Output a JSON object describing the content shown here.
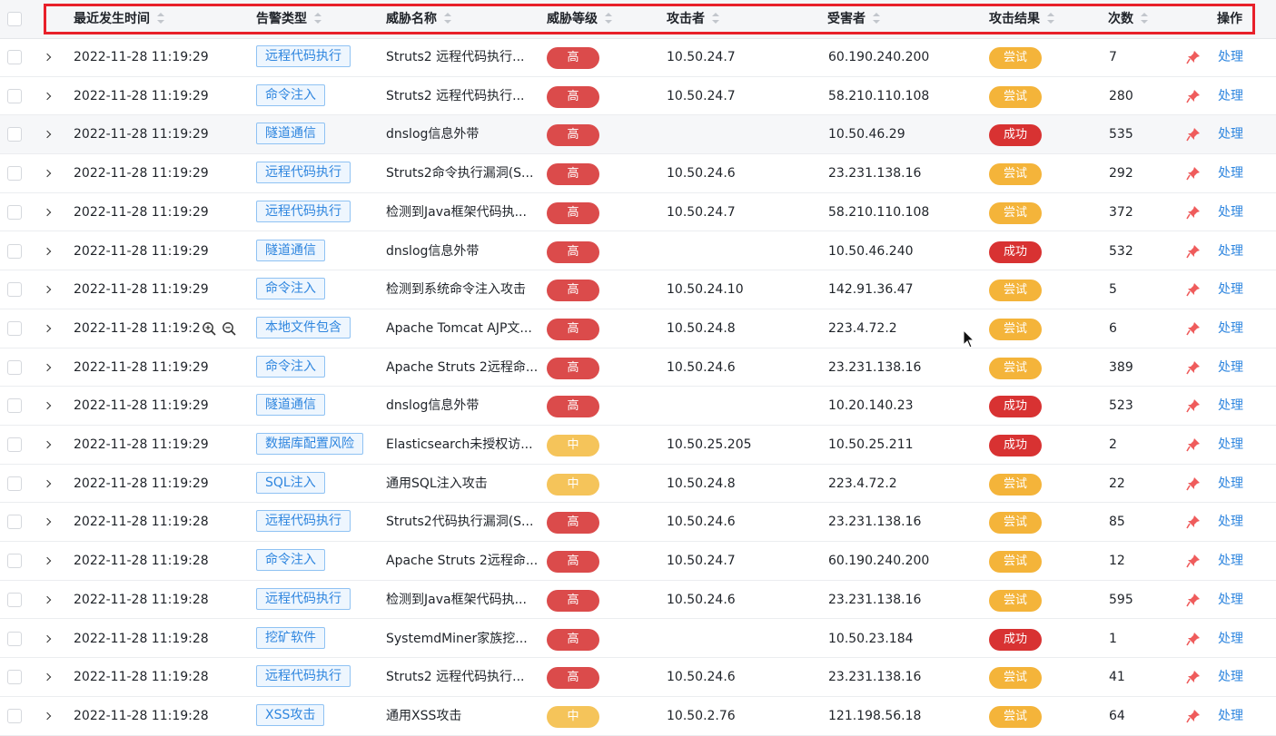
{
  "table": {
    "columns": {
      "time": "最近发生时间",
      "type": "告警类型",
      "name": "威胁名称",
      "level": "威胁等级",
      "attacker": "攻击者",
      "victim": "受害者",
      "result": "攻击结果",
      "count": "次数",
      "action": "操作"
    },
    "rows": [
      {
        "time": "2022-11-28 11:19:29",
        "type": "远程代码执行",
        "name": "Struts2 远程代码执行...",
        "level": "高",
        "attacker": "10.50.24.7",
        "victim": "60.190.240.200",
        "result": "尝试",
        "count": "7",
        "action": "处理"
      },
      {
        "time": "2022-11-28 11:19:29",
        "type": "命令注入",
        "name": "Struts2 远程代码执行...",
        "level": "高",
        "attacker": "10.50.24.7",
        "victim": "58.210.110.108",
        "result": "尝试",
        "count": "280",
        "action": "处理"
      },
      {
        "time": "2022-11-28 11:19:29",
        "type": "隧道通信",
        "name": "dnslog信息外带",
        "level": "高",
        "attacker": "",
        "victim": "10.50.46.29",
        "result": "成功",
        "count": "535",
        "action": "处理"
      },
      {
        "time": "2022-11-28 11:19:29",
        "type": "远程代码执行",
        "name": "Struts2命令执行漏洞(S...",
        "level": "高",
        "attacker": "10.50.24.6",
        "victim": "23.231.138.16",
        "result": "尝试",
        "count": "292",
        "action": "处理"
      },
      {
        "time": "2022-11-28 11:19:29",
        "type": "远程代码执行",
        "name": "检测到Java框架代码执...",
        "level": "高",
        "attacker": "10.50.24.7",
        "victim": "58.210.110.108",
        "result": "尝试",
        "count": "372",
        "action": "处理"
      },
      {
        "time": "2022-11-28 11:19:29",
        "type": "隧道通信",
        "name": "dnslog信息外带",
        "level": "高",
        "attacker": "",
        "victim": "10.50.46.240",
        "result": "成功",
        "count": "532",
        "action": "处理"
      },
      {
        "time": "2022-11-28 11:19:29",
        "type": "命令注入",
        "name": "检测到系统命令注入攻击",
        "level": "高",
        "attacker": "10.50.24.10",
        "victim": "142.91.36.47",
        "result": "尝试",
        "count": "5",
        "action": "处理"
      },
      {
        "time": "2022-11-28 11:19:2",
        "type": "本地文件包含",
        "name": "Apache Tomcat AJP文...",
        "level": "高",
        "attacker": "10.50.24.8",
        "victim": "223.4.72.2",
        "result": "尝试",
        "count": "6",
        "action": "处理"
      },
      {
        "time": "2022-11-28 11:19:29",
        "type": "命令注入",
        "name": "Apache Struts 2远程命...",
        "level": "高",
        "attacker": "10.50.24.6",
        "victim": "23.231.138.16",
        "result": "尝试",
        "count": "389",
        "action": "处理"
      },
      {
        "time": "2022-11-28 11:19:29",
        "type": "隧道通信",
        "name": "dnslog信息外带",
        "level": "高",
        "attacker": "",
        "victim": "10.20.140.23",
        "result": "成功",
        "count": "523",
        "action": "处理"
      },
      {
        "time": "2022-11-28 11:19:29",
        "type": "数据库配置风险",
        "name": "Elasticsearch未授权访...",
        "level": "中",
        "attacker": "10.50.25.205",
        "victim": "10.50.25.211",
        "result": "成功",
        "count": "2",
        "action": "处理"
      },
      {
        "time": "2022-11-28 11:19:29",
        "type": "SQL注入",
        "name": "通用SQL注入攻击",
        "level": "中",
        "attacker": "10.50.24.8",
        "victim": "223.4.72.2",
        "result": "尝试",
        "count": "22",
        "action": "处理"
      },
      {
        "time": "2022-11-28 11:19:28",
        "type": "远程代码执行",
        "name": "Struts2代码执行漏洞(S...",
        "level": "高",
        "attacker": "10.50.24.6",
        "victim": "23.231.138.16",
        "result": "尝试",
        "count": "85",
        "action": "处理"
      },
      {
        "time": "2022-11-28 11:19:28",
        "type": "命令注入",
        "name": "Apache Struts 2远程命...",
        "level": "高",
        "attacker": "10.50.24.7",
        "victim": "60.190.240.200",
        "result": "尝试",
        "count": "12",
        "action": "处理"
      },
      {
        "time": "2022-11-28 11:19:28",
        "type": "远程代码执行",
        "name": "检测到Java框架代码执...",
        "level": "高",
        "attacker": "10.50.24.6",
        "victim": "23.231.138.16",
        "result": "尝试",
        "count": "595",
        "action": "处理"
      },
      {
        "time": "2022-11-28 11:19:28",
        "type": "挖矿软件",
        "name": "SystemdMiner家族挖...",
        "level": "高",
        "attacker": "",
        "victim": "10.50.23.184",
        "result": "成功",
        "count": "1",
        "action": "处理"
      },
      {
        "time": "2022-11-28 11:19:28",
        "type": "远程代码执行",
        "name": "Struts2 远程代码执行...",
        "level": "高",
        "attacker": "10.50.24.6",
        "victim": "23.231.138.16",
        "result": "尝试",
        "count": "41",
        "action": "处理"
      },
      {
        "time": "2022-11-28 11:19:28",
        "type": "XSS攻击",
        "name": "通用XSS攻击",
        "level": "中",
        "attacker": "10.50.2.76",
        "victim": "121.198.56.18",
        "result": "尝试",
        "count": "64",
        "action": "处理"
      }
    ]
  }
}
